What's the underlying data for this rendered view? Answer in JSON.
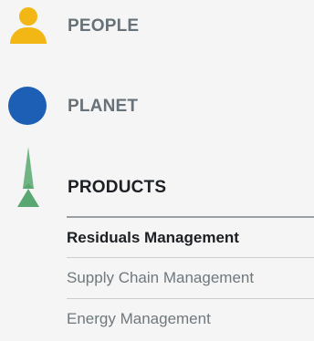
{
  "nav": {
    "people": {
      "label": "PEOPLE",
      "icon": "person-icon",
      "color": "#f2b714"
    },
    "planet": {
      "label": "PLANET",
      "icon": "globe-icon",
      "color": "#1d5fb4"
    },
    "products": {
      "label": "PRODUCTS",
      "icon": "tree-icon",
      "color": "#5aa773"
    }
  },
  "submenu": {
    "items": [
      {
        "label": "Residuals Management",
        "active": true
      },
      {
        "label": "Supply Chain Management",
        "active": false
      },
      {
        "label": "Energy Management",
        "active": false
      }
    ]
  }
}
